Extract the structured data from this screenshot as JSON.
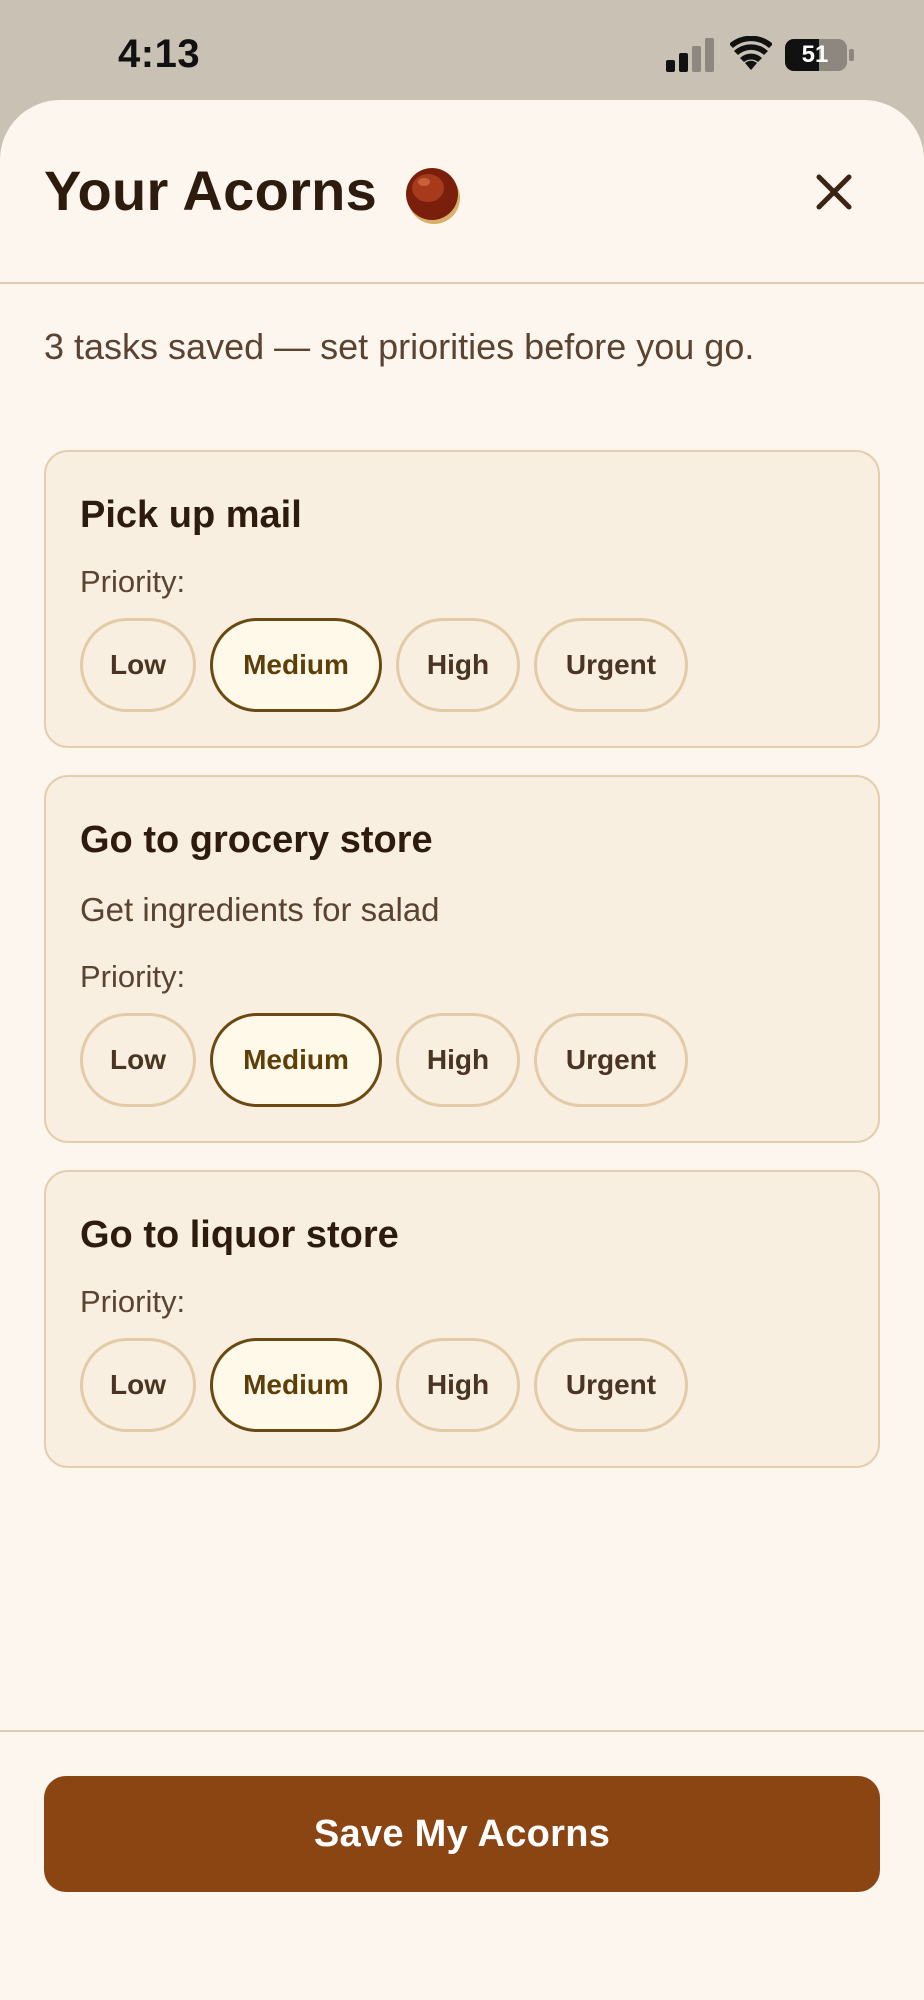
{
  "status_bar": {
    "time": "4:13",
    "battery_level": "51",
    "icons": [
      "signal-icon",
      "wifi-icon",
      "battery-icon"
    ]
  },
  "header": {
    "title": "Your Acorns",
    "title_icon": "acorn-icon",
    "close_icon": "close-icon"
  },
  "subtitle": "3 tasks saved — set priorities before you go.",
  "priority_label": "Priority:",
  "priority_options": [
    "Low",
    "Medium",
    "High",
    "Urgent"
  ],
  "tasks": [
    {
      "title": "Pick up mail",
      "description": "",
      "priority": "Medium"
    },
    {
      "title": "Go to grocery store",
      "description": "Get ingredients for salad",
      "priority": "Medium"
    },
    {
      "title": "Go to liquor store",
      "description": "",
      "priority": "Medium"
    }
  ],
  "footer": {
    "save_label": "Save My Acorns"
  },
  "colors": {
    "accent": "#8b4513",
    "selected_border": "#6b4a12",
    "background": "#fcf6ee",
    "card_background": "#f8efe1"
  }
}
